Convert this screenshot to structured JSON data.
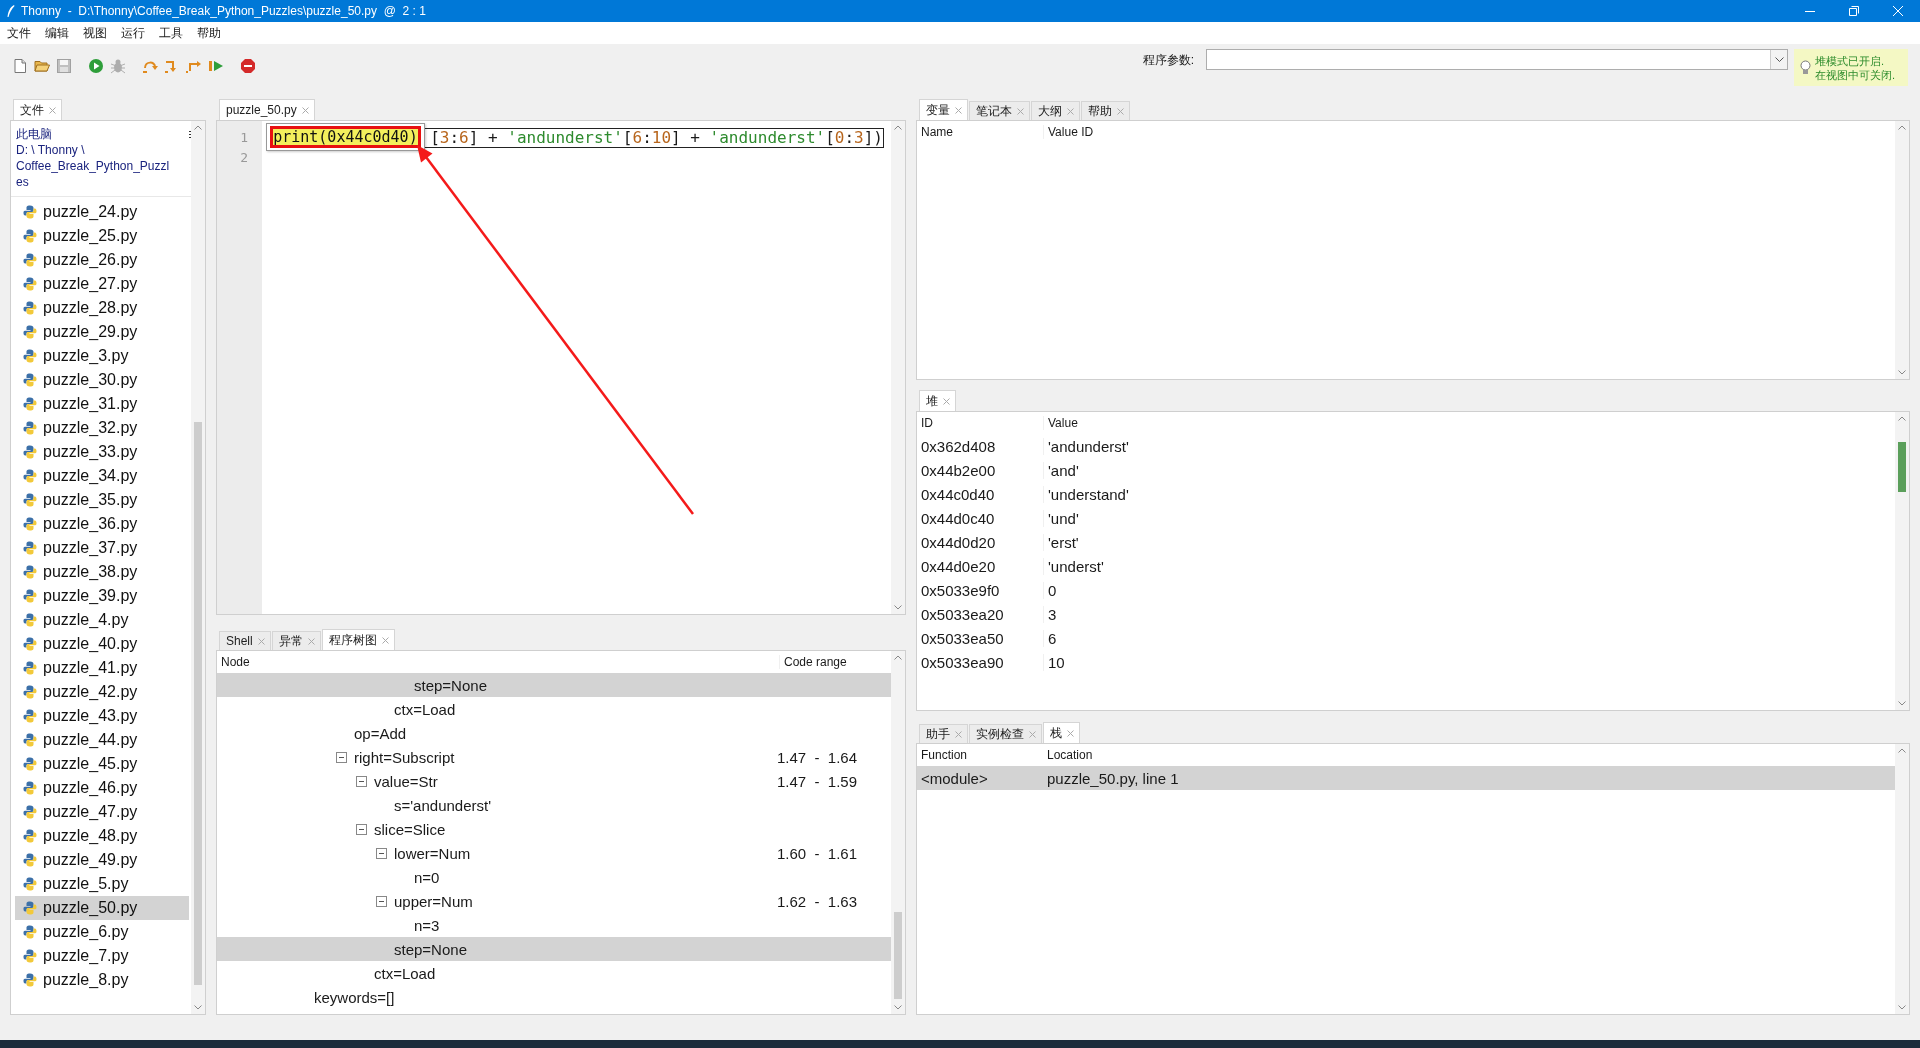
{
  "window": {
    "title": "Thonny  -  D:\\Thonny\\Coffee_Break_Python_Puzzles\\puzzle_50.py  @  2 : 1"
  },
  "menu": [
    "文件",
    "编辑",
    "视图",
    "运行",
    "工具",
    "帮助"
  ],
  "toolbar": {
    "buttons": [
      {
        "kind": "new",
        "disabled": false
      },
      {
        "kind": "open",
        "disabled": false
      },
      {
        "kind": "save",
        "disabled": true
      },
      {
        "kind": "run",
        "disabled": false
      },
      {
        "kind": "debug",
        "disabled": true
      },
      {
        "kind": "step_over",
        "disabled": false
      },
      {
        "kind": "step_into",
        "disabled": false
      },
      {
        "kind": "step_out",
        "disabled": false
      },
      {
        "kind": "resume",
        "disabled": false
      },
      {
        "kind": "stop",
        "disabled": false
      }
    ],
    "args_label": "程序参数:",
    "tip": [
      "堆模式已开启.",
      "在视图中可关闭."
    ]
  },
  "files": {
    "tabs": [
      {
        "label": "文件",
        "selected": true
      }
    ],
    "location": "此电脑",
    "path": "D: \\ Thonny \\ Coffee_Break_Python_Puzzles",
    "items": [
      {
        "name": "puzzle_24.py",
        "selected": false
      },
      {
        "name": "puzzle_25.py",
        "selected": false
      },
      {
        "name": "puzzle_26.py",
        "selected": false
      },
      {
        "name": "puzzle_27.py",
        "selected": false
      },
      {
        "name": "puzzle_28.py",
        "selected": false
      },
      {
        "name": "puzzle_29.py",
        "selected": false
      },
      {
        "name": "puzzle_3.py",
        "selected": false
      },
      {
        "name": "puzzle_30.py",
        "selected": false
      },
      {
        "name": "puzzle_31.py",
        "selected": false
      },
      {
        "name": "puzzle_32.py",
        "selected": false
      },
      {
        "name": "puzzle_33.py",
        "selected": false
      },
      {
        "name": "puzzle_34.py",
        "selected": false
      },
      {
        "name": "puzzle_35.py",
        "selected": false
      },
      {
        "name": "puzzle_36.py",
        "selected": false
      },
      {
        "name": "puzzle_37.py",
        "selected": false
      },
      {
        "name": "puzzle_38.py",
        "selected": false
      },
      {
        "name": "puzzle_39.py",
        "selected": false
      },
      {
        "name": "puzzle_4.py",
        "selected": false
      },
      {
        "name": "puzzle_40.py",
        "selected": false
      },
      {
        "name": "puzzle_41.py",
        "selected": false
      },
      {
        "name": "puzzle_42.py",
        "selected": false
      },
      {
        "name": "puzzle_43.py",
        "selected": false
      },
      {
        "name": "puzzle_44.py",
        "selected": false
      },
      {
        "name": "puzzle_45.py",
        "selected": false
      },
      {
        "name": "puzzle_46.py",
        "selected": false
      },
      {
        "name": "puzzle_47.py",
        "selected": false
      },
      {
        "name": "puzzle_48.py",
        "selected": false
      },
      {
        "name": "puzzle_49.py",
        "selected": false
      },
      {
        "name": "puzzle_5.py",
        "selected": false
      },
      {
        "name": "puzzle_50.py",
        "selected": true
      },
      {
        "name": "puzzle_6.py",
        "selected": false
      },
      {
        "name": "puzzle_7.py",
        "selected": false
      },
      {
        "name": "puzzle_8.py",
        "selected": false
      }
    ]
  },
  "editor": {
    "tabs": [
      {
        "label": "puzzle_50.py",
        "selected": true
      }
    ],
    "lines": [
      {
        "number": "1",
        "text": "[3:6] + 'andunderst'[6:10] + 'andunderst'[0:3])",
        "current": true
      },
      {
        "number": "2"
      }
    ],
    "popup": {
      "text": "print(0x44c0d40)"
    }
  },
  "tree": {
    "tabs": [
      {
        "label": "Shell",
        "selected": false
      },
      {
        "label": "异常",
        "selected": false
      },
      {
        "label": "程序树图",
        "selected": true
      }
    ],
    "columns": [
      "Node",
      "Code range"
    ],
    "rows": [
      {
        "children": [
          {
            "children": [
              {
                "children": [
                  {
                    "children": [
                      {
                        "children": [
                          {
                            "label": "step=None",
                            "selected": true
                          }
                        ]
                      },
                      {
                        "label": "ctx=Load",
                        "selected": false
                      }
                    ]
                  }
                ]
              },
              {
                "label": "op=Add",
                "selected": false
              },
              {
                "label": "right=Subscript",
                "range": "1.47  -  1.64",
                "selected": false,
                "expanded": true,
                "children": [
                  {
                    "label": "value=Str",
                    "range": "1.47  -  1.59",
                    "selected": false,
                    "expanded": true,
                    "children": [
                      {
                        "label": "s='andunderst'",
                        "selected": false
                      }
                    ]
                  },
                  {
                    "label": "slice=Slice",
                    "selected": false,
                    "expanded": true,
                    "children": [
                      {
                        "label": "lower=Num",
                        "range": "1.60  -  1.61",
                        "selected": false,
                        "expanded": true,
                        "children": [
                          {
                            "label": "n=0",
                            "selected": false
                          }
                        ]
                      },
                      {
                        "label": "upper=Num",
                        "range": "1.62  -  1.63",
                        "selected": false,
                        "expanded": true,
                        "children": [
                          {
                            "label": "n=3",
                            "selected": false
                          }
                        ]
                      },
                      {
                        "label": "step=None",
                        "selected": true
                      }
                    ]
                  },
                  {
                    "label": "ctx=Load",
                    "selected": false
                  }
                ]
              }
            ]
          }
        ]
      },
      {
        "label": "keywords=[]",
        "selected": false
      }
    ]
  },
  "variables": {
    "tabs": [
      {
        "label": "变量",
        "selected": true
      },
      {
        "label": "笔记本",
        "selected": false
      },
      {
        "label": "大纲",
        "selected": false
      },
      {
        "label": "帮助",
        "selected": false
      }
    ],
    "columns": [
      "Name",
      "Value ID"
    ]
  },
  "heap": {
    "tabs": [
      {
        "label": "堆",
        "selected": true
      }
    ],
    "columns": [
      "ID",
      "Value"
    ],
    "rows": [
      {
        "id": "0x362d408",
        "value": "'andunderst'"
      },
      {
        "id": "0x44b2e00",
        "value": "'and'"
      },
      {
        "id": "0x44c0d40",
        "value": "'understand'"
      },
      {
        "id": "0x44d0c40",
        "value": "'und'"
      },
      {
        "id": "0x44d0d20",
        "value": "'erst'"
      },
      {
        "id": "0x44d0e20",
        "value": "'underst'"
      },
      {
        "id": "0x5033e9f0",
        "value": "0"
      },
      {
        "id": "0x5033ea20",
        "value": "3"
      },
      {
        "id": "0x5033ea50",
        "value": "6"
      },
      {
        "id": "0x5033ea90",
        "value": "10"
      }
    ]
  },
  "stack": {
    "tabs": [
      {
        "label": "助手",
        "selected": false
      },
      {
        "label": "实例检查",
        "selected": false
      },
      {
        "label": "栈",
        "selected": true
      }
    ],
    "columns": [
      "Function",
      "Location"
    ],
    "rows": [
      {
        "function": "<module>",
        "location": "puzzle_50.py, line 1",
        "selected": true
      }
    ]
  }
}
